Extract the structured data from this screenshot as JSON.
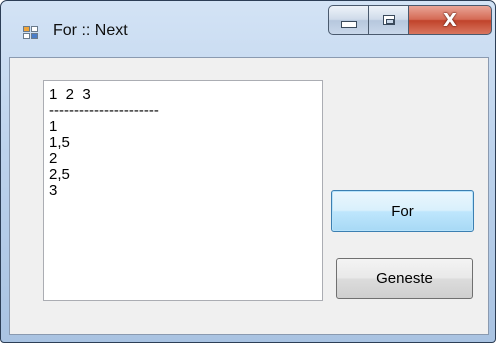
{
  "window": {
    "title": "For :: Next"
  },
  "caption_buttons": {
    "minimize_icon": "minimize-icon",
    "maximize_icon": "maximize-icon",
    "close_glyph": "X"
  },
  "listbox": {
    "items": [
      "1  2  3",
      "----------------------",
      "1",
      "1,5",
      "2",
      "2,5",
      "3"
    ]
  },
  "buttons": {
    "for_label": "For",
    "nested_label": "Geneste"
  },
  "colors": {
    "accent_focus": "#3c7fb1",
    "close_red": "#c0432b"
  }
}
